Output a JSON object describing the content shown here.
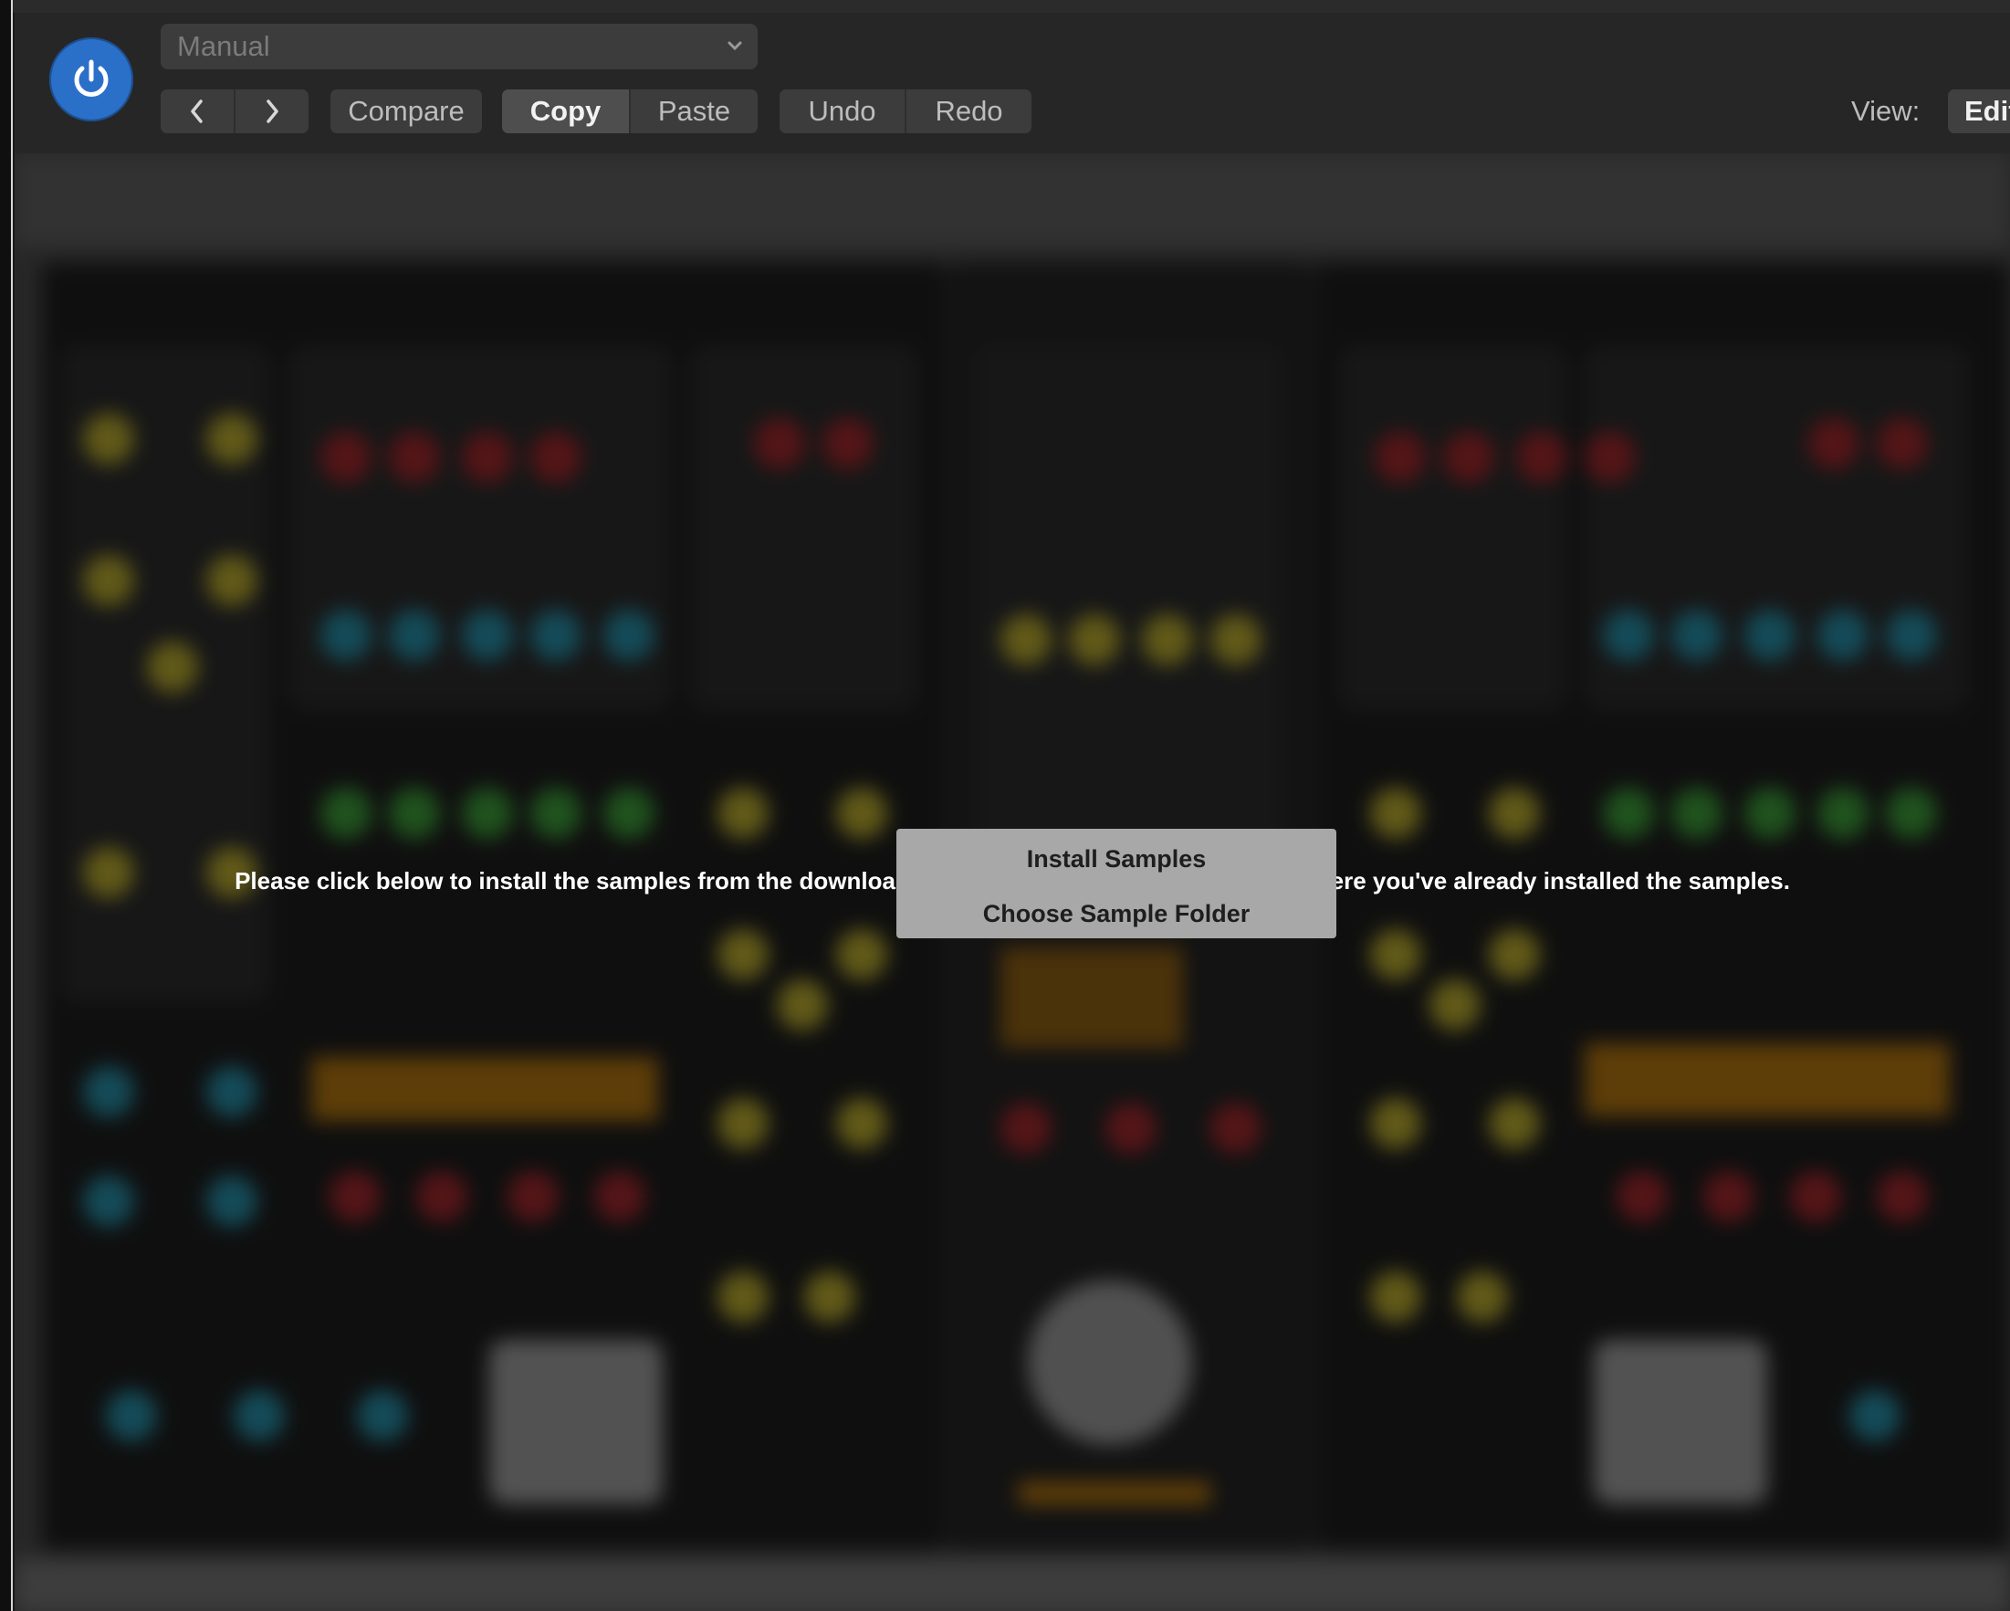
{
  "toolbar": {
    "preset": "Manual",
    "compare": "Compare",
    "copy": "Copy",
    "paste": "Paste",
    "undo": "Undo",
    "redo": "Redo",
    "view_label": "View:",
    "view_value": "Edit"
  },
  "icons": {
    "power": "power-icon",
    "back": "chevron-left-icon",
    "forward": "chevron-right-icon",
    "dropdown": "chevron-down-icon"
  },
  "colors": {
    "power_blue": "#2a70c9",
    "toolbar_bg": "#262626",
    "dialog_bg": "#a8a8a8"
  },
  "install_prompt": {
    "message": "Please click below to install the samples from the downloaded archive or point to the location where you've already installed the samples.",
    "install_button": "Install Samples",
    "choose_button": "Choose Sample Folder"
  }
}
